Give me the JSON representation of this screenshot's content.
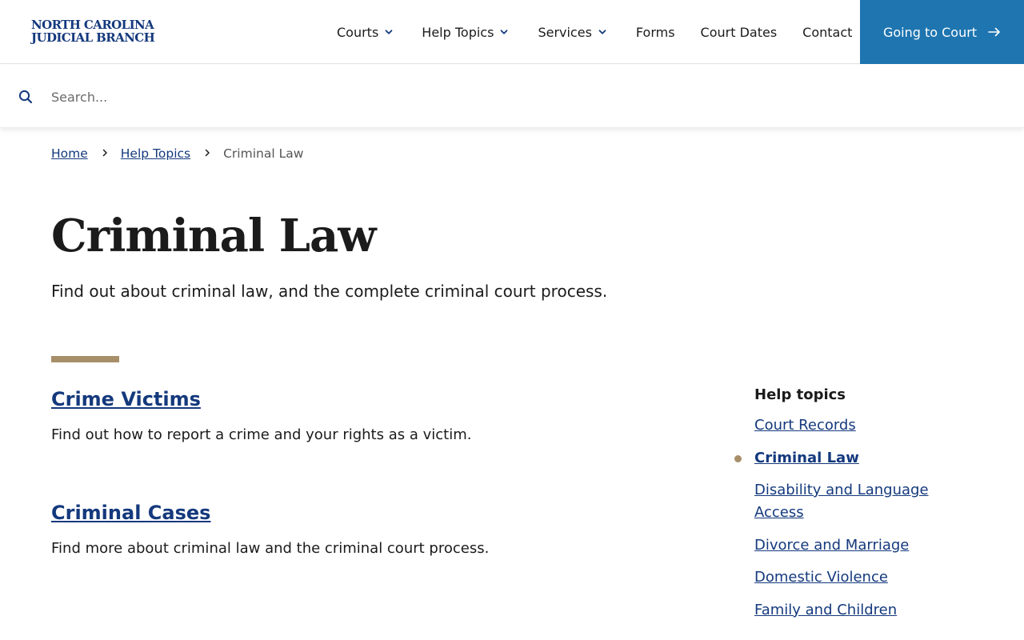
{
  "header": {
    "logo": {
      "line1": "NORTH CAROLINA",
      "line2": "JUDICIAL BRANCH"
    },
    "nav": [
      {
        "label": "Courts",
        "dropdown": true
      },
      {
        "label": "Help Topics",
        "dropdown": true
      },
      {
        "label": "Services",
        "dropdown": true
      },
      {
        "label": "Forms",
        "dropdown": false
      },
      {
        "label": "Court Dates",
        "dropdown": false
      },
      {
        "label": "Contact",
        "dropdown": false
      }
    ],
    "cta": {
      "label": "Going to Court",
      "icon": "arrow-right-icon"
    }
  },
  "search": {
    "placeholder": "Search...",
    "value": "",
    "icon": "search-icon"
  },
  "breadcrumb": {
    "home": "Home",
    "section": "Help Topics",
    "current": "Criminal Law"
  },
  "page": {
    "title": "Criminal Law",
    "intro": "Find out about criminal law, and the complete criminal court process."
  },
  "topics": [
    {
      "title": "Crime Victims",
      "description": "Find out how to report a crime and your rights as a victim."
    },
    {
      "title": "Criminal Cases",
      "description": "Find more about criminal law and the criminal court process."
    }
  ],
  "sidebar": {
    "title": "Help topics",
    "items": [
      {
        "label": "Court Records",
        "active": false
      },
      {
        "label": "Criminal Law",
        "active": true
      },
      {
        "label": "Disability and Language Access",
        "active": false
      },
      {
        "label": "Divorce and Marriage",
        "active": false
      },
      {
        "label": "Domestic Violence",
        "active": false
      },
      {
        "label": "Family and Children",
        "active": false
      }
    ]
  },
  "colors": {
    "brand_blue": "#14397d",
    "cta_blue": "#1e75b0",
    "accent_gold": "#a78f6a",
    "text": "#1b1b1b"
  }
}
